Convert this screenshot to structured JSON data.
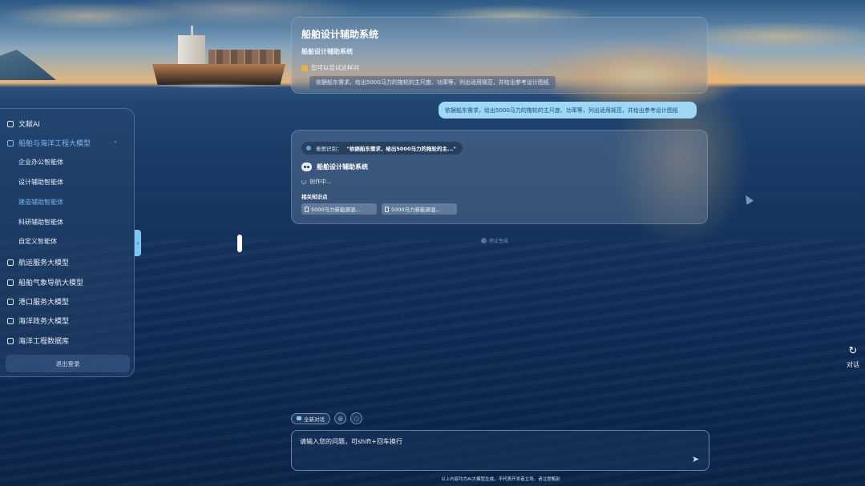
{
  "top_card": {
    "title": "船舶设计辅助系统",
    "subtitle": "船舶设计辅助系统",
    "hint": "您可以尝试这样问",
    "suggestion": "依据船东需求，给出5000马力的拖轮的主尺度、功率等，列出适用规范，并给出参考设计图纸"
  },
  "user_message": "依据船东需求，给出5000马力的拖轮的主尺度、功率等，列出适用规范，并给出参考设计图纸",
  "response": {
    "intent_label": "意图识别：",
    "intent_text": "\"依据船东需求，给出5000马力的拖轮的主...\"",
    "bot_name": "船舶设计辅助系统",
    "status": "创作中...",
    "knowledge_label": "相关知识点",
    "docs": [
      "5000马力新能源混...",
      "5000马力新能源混..."
    ]
  },
  "stop_label": "停止生成",
  "sidebar": {
    "items": [
      {
        "label": "文献AI",
        "icon": "chat-icon"
      },
      {
        "label": "船舶与海洋工程大模型",
        "icon": "ship-icon",
        "expanded": true
      },
      {
        "label": "航运服务大模型",
        "icon": "anchor-icon"
      },
      {
        "label": "船舶气象导航大模型",
        "icon": "weather-icon"
      },
      {
        "label": "港口服务大模型",
        "icon": "port-icon"
      },
      {
        "label": "海洋政务大模型",
        "icon": "gov-icon"
      },
      {
        "label": "海洋工程数据库",
        "icon": "database-icon"
      }
    ],
    "sub_items": [
      {
        "label": "企业办公智能体",
        "active": false
      },
      {
        "label": "设计辅助智能体",
        "active": false
      },
      {
        "label": "建造辅助智能体",
        "active": true
      },
      {
        "label": "科研辅助智能体",
        "active": false
      },
      {
        "label": "自定义智能体",
        "active": false
      }
    ],
    "logout": "退出登录",
    "collapse_glyph": "›"
  },
  "new_conversation": {
    "icon": "refresh-icon",
    "glyph": "↻",
    "label": "对话"
  },
  "toolbar": {
    "new_chat_label": "全新对话",
    "tool1_glyph": "◎",
    "tool2_glyph": "◌"
  },
  "input": {
    "placeholder": "请输入您的问题，可shift+回车换行",
    "send_glyph": "➤"
  },
  "disclaimer": "以上内容均为AI大模型生成，不代表开发者立场，请注意甄别",
  "colors": {
    "accent": "#7cc7f2",
    "user_bubble": "#9ed8f5",
    "active_nav": "#7fb8f0"
  }
}
